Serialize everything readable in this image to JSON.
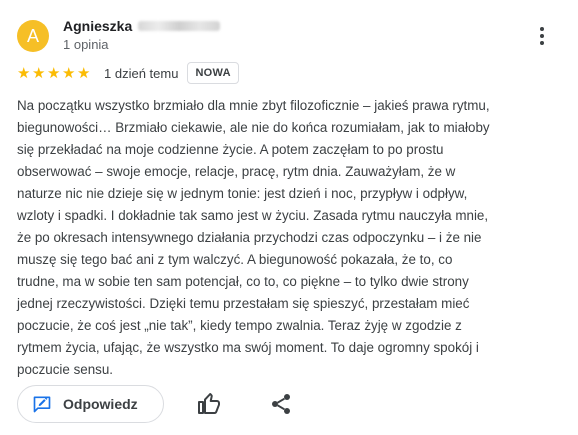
{
  "review": {
    "avatar_letter": "A",
    "author_name": "Agnieszka",
    "author_meta": "1 opinia",
    "rating": 5,
    "rating_max": 5,
    "date": "1 dzień temu",
    "badge": "NOWA",
    "text": "Na początku wszystko brzmiało dla mnie zbyt filozoficznie – jakieś prawa rytmu,\nbiegunowości… Brzmiało ciekawie, ale nie do końca rozumiałam, jak to miałoby\nsię przekładać na moje codzienne życie. A potem zaczęłam to po prostu\nobserwować – swoje emocje, relacje, pracę, rytm dnia. Zauważyłam, że w\nnaturze nic nie dzieje się w jednym tonie: jest dzień i noc, przypływ i odpływ,\nwzloty i spadki. I dokładnie tak samo jest w życiu. Zasada rytmu nauczyła mnie,\nże po okresach intensywnego działania przychodzi czas odpoczynku – i że nie\nmuszę się tego bać ani z tym walczyć. A biegunowość pokazała, że to, co\ntrudne, ma w sobie ten sam potencjał, co to, co piękne – to tylko dwie strony\njednej rzeczywistości. Dzięki temu przestałam się spieszyć, przestałam mieć\npoczucie, że coś jest „nie tak”, kiedy tempo zwalnia. Teraz żyję w zgodzie z\nrytmem życia, ufając, że wszystko ma swój moment. To daje ogromny spokój i\npoczucie sensu."
  },
  "actions": {
    "reply_label": "Odpowiedz",
    "reply_icon": "edit-comment-icon",
    "like_icon": "thumb-up-icon",
    "share_icon": "share-icon",
    "more_icon": "more-vert-icon"
  },
  "colors": {
    "avatar_bg": "#f6bf26",
    "star": "#fbbc04",
    "accent_blue": "#1a73e8"
  }
}
